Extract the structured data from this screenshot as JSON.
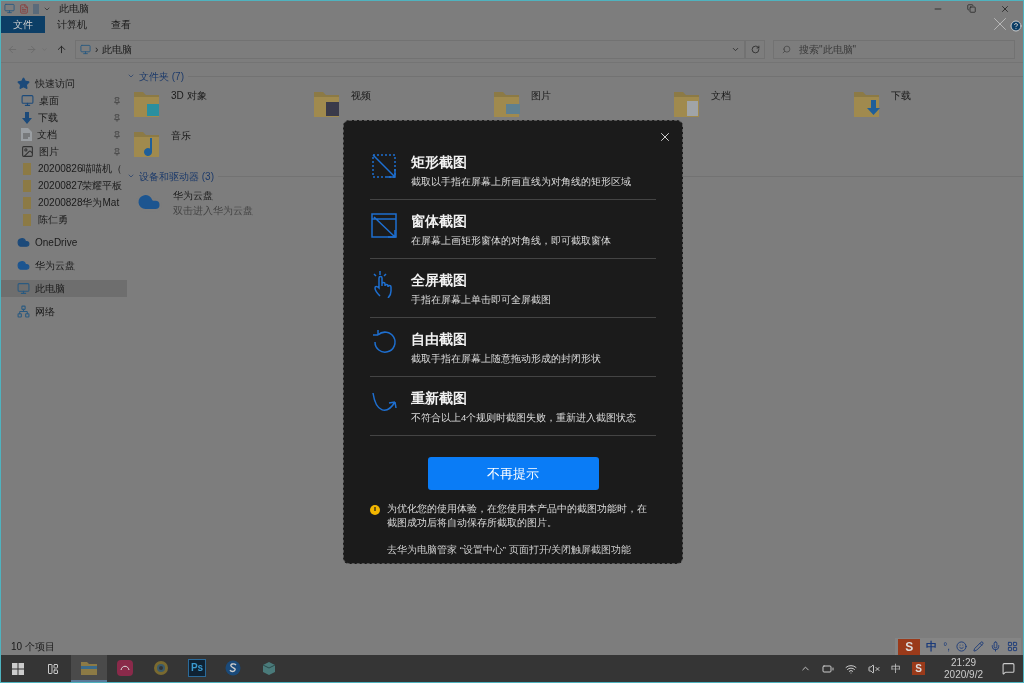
{
  "window": {
    "title": "此电脑"
  },
  "ribbon_tabs": [
    {
      "label": "文件",
      "selected": true
    },
    {
      "label": "计算机",
      "selected": false
    },
    {
      "label": "查看",
      "selected": false
    }
  ],
  "address": {
    "separator": "›",
    "path": "此电脑"
  },
  "search": {
    "placeholder": "搜索\"此电脑\""
  },
  "sidebar": {
    "items": [
      {
        "label": "快速访问",
        "kind": "star",
        "selected": false,
        "children": [
          {
            "label": "桌面",
            "kind": "desktop",
            "pinned": true,
            "selected": false
          },
          {
            "label": "下载",
            "kind": "download",
            "pinned": true,
            "selected": false
          },
          {
            "label": "文档",
            "kind": "document",
            "pinned": true,
            "selected": false
          },
          {
            "label": "图片",
            "kind": "image",
            "pinned": true,
            "selected": false
          },
          {
            "label": "20200826喵喵机（",
            "kind": "folder",
            "pinned": false,
            "selected": false
          },
          {
            "label": "20200827荣耀平板",
            "kind": "folder",
            "pinned": false,
            "selected": false
          },
          {
            "label": "20200828华为Mat",
            "kind": "folder",
            "pinned": false,
            "selected": false
          },
          {
            "label": "陈仁勇",
            "kind": "folder",
            "pinned": false,
            "selected": false
          }
        ]
      },
      {
        "label": "OneDrive",
        "kind": "onedrive",
        "selected": false
      },
      {
        "label": "华为云盘",
        "kind": "cloud",
        "selected": false
      },
      {
        "label": "此电脑",
        "kind": "pc",
        "selected": true
      },
      {
        "label": "网络",
        "kind": "network",
        "selected": false
      }
    ]
  },
  "sections": [
    {
      "title": "文件夹 (7)",
      "expanded": true,
      "items": [
        {
          "name": "3D 对象",
          "kind": "cube"
        },
        {
          "name": "视频",
          "kind": "video"
        },
        {
          "name": "图片",
          "kind": "image"
        },
        {
          "name": "文档",
          "kind": "document"
        },
        {
          "name": "下载",
          "kind": "download"
        },
        {
          "name": "音乐",
          "kind": "music"
        }
      ]
    },
    {
      "title": "设备和驱动器 (3)",
      "expanded": true,
      "items": [
        {
          "name": "华为云盘",
          "subtitle": "双击进入华为云盘",
          "kind": "cloud"
        }
      ]
    }
  ],
  "status_bar": {
    "text": "10 个项目"
  },
  "dialog": {
    "options": [
      {
        "kind": "rect",
        "title": "矩形截图",
        "description": "截取以手指在屏幕上所画直线为对角线的矩形区域"
      },
      {
        "kind": "window",
        "title": "窗体截图",
        "description": "在屏幕上画矩形窗体的对角线，即可截取窗体"
      },
      {
        "kind": "full",
        "title": "全屏截图",
        "description": "手指在屏幕上单击即可全屏截图"
      },
      {
        "kind": "free",
        "title": "自由截图",
        "description": "截取手指在屏幕上随意拖动形成的封闭形状"
      },
      {
        "kind": "retry",
        "title": "重新截图",
        "description": "不符合以上4个规则时截图失败，重新进入截图状态"
      }
    ],
    "button": "不再提示",
    "notice": "为优化您的使用体验，在您使用本产品中的截图功能时，在截图成功后将自动保存所截取的图片。",
    "footer": "去华为电脑管家 “设置中心” 页面打开/关闭触屏截图功能"
  },
  "ime_bar": {
    "logo": "S",
    "mode": "中",
    "punctuation": "°,"
  },
  "taskbar": {
    "apps": [
      {
        "kind": "explorer",
        "selected": true
      },
      {
        "kind": "pink",
        "selected": false
      },
      {
        "kind": "wheel",
        "selected": false
      },
      {
        "kind": "ps",
        "label": "Ps",
        "selected": false
      },
      {
        "kind": "s",
        "selected": false
      },
      {
        "kind": "box",
        "selected": false
      }
    ],
    "tray": {
      "ime": "中",
      "logo": "S",
      "time": "21:29",
      "date": "2020/9/2"
    }
  }
}
